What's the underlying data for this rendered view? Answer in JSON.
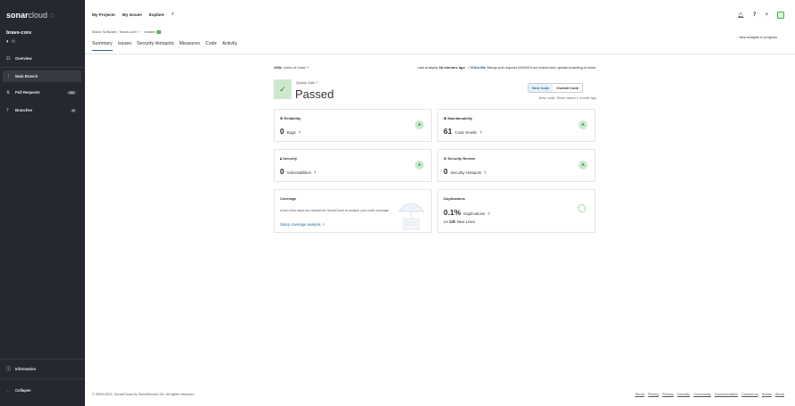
{
  "app": {
    "logo_main": "sonar",
    "logo_rest": "cloud"
  },
  "sidebar": {
    "project_name": "brave-core",
    "items": [
      {
        "label": "Overview",
        "icon": "overview-icon"
      },
      {
        "label": "Main Branch",
        "icon": "branch-icon"
      },
      {
        "label": "Pull Requests",
        "icon": "pull-request-icon",
        "badge": "183"
      },
      {
        "label": "Branches",
        "icon": "branches-icon",
        "badge": "0"
      }
    ],
    "information": "Information",
    "collapse": "Collapse"
  },
  "topnav": {
    "items": [
      "My Projects",
      "My Issues",
      "Explore"
    ]
  },
  "breadcrumb": {
    "org": "Brave Software",
    "project": "brave-core",
    "branch": "master"
  },
  "tabs": [
    "Summary",
    "Issues",
    "Security Hotspots",
    "Measures",
    "Code",
    "Activity"
  ],
  "background_status": "New analysis in progress",
  "summary": {
    "loc_value": "168k",
    "loc_label": "Lines of Code",
    "last_analysis_prefix": "Last analysis",
    "last_analysis_time": "18 minutes ago",
    "commit_hash": "0152e00b",
    "commit_message": "Merge pull request #16633 from brave/dont-update-branding-in-tests"
  },
  "quality_gate": {
    "label": "Quality Gate",
    "status": "Passed"
  },
  "code_toggle": {
    "new_code": "New Code",
    "overall_code": "Overall Code",
    "note": "New code: Since about 1 month ago"
  },
  "cards": {
    "reliability": {
      "title": "Reliability",
      "value": "0",
      "sub": "Bugs",
      "grade": "A"
    },
    "maintainability": {
      "title": "Maintainability",
      "value": "61",
      "sub": "Code Smells",
      "grade": "A"
    },
    "security": {
      "title": "Security",
      "value": "0",
      "sub": "Vulnerabilities",
      "grade": "A"
    },
    "security_review": {
      "title": "Security Review",
      "value": "0",
      "sub": "Security Hotspots",
      "grade": "A"
    },
    "coverage": {
      "title": "Coverage",
      "text": "A few extra steps are needed for SonarCloud to analyze your code coverage",
      "link": "Setup coverage analysis"
    },
    "duplications": {
      "title": "Duplications",
      "value": "0.1%",
      "sub": "Duplications",
      "lines_value": "22k",
      "lines_label": "New Lines",
      "lines_prefix": "on"
    }
  },
  "footer": {
    "copyright": "© 2008-2022, SonarCloud by SonarSource SA. All rights reserved.",
    "links": [
      "Terms",
      "Pricing",
      "Privacy",
      "Security",
      "Community",
      "Documentation",
      "Contact us",
      "Status",
      "About"
    ]
  },
  "colors": {
    "sidebar_bg": "#25292f",
    "accent": "#236a97",
    "success": "#3fb34f"
  }
}
